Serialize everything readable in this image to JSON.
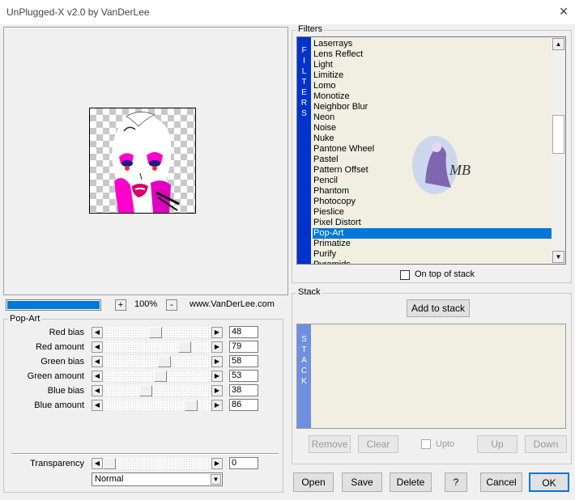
{
  "window": {
    "title": "UnPlugged-X v2.0 by VanDerLee",
    "close_glyph": "×"
  },
  "preview": {
    "progress_fraction": 1.0
  },
  "zoom": {
    "minus": "-",
    "plus": "+",
    "value": "100%"
  },
  "credits": {
    "url": "www.VanDerLee.com"
  },
  "popart": {
    "label": "Pop-Art",
    "sliders": [
      {
        "label": "Red bias",
        "value": "48",
        "fraction": 0.48
      },
      {
        "label": "Red amount",
        "value": "79",
        "fraction": 0.79
      },
      {
        "label": "Green bias",
        "value": "58",
        "fraction": 0.58
      },
      {
        "label": "Green amount",
        "value": "53",
        "fraction": 0.53
      },
      {
        "label": "Blue bias",
        "value": "38",
        "fraction": 0.38
      },
      {
        "label": "Blue amount",
        "value": "86",
        "fraction": 0.86
      }
    ],
    "transparency": {
      "label": "Transparency",
      "value": "0",
      "fraction": 0.0
    },
    "blend_mode": "Normal"
  },
  "filters": {
    "label": "Filters",
    "strip_text": "FILTERS",
    "items": [
      "Laserrays",
      "Lens Reflect",
      "Light",
      "Limitize",
      "Lomo",
      "Monotize",
      "Neighbor Blur",
      "Neon",
      "Noise",
      "Nuke",
      "Pantone Wheel",
      "Pastel",
      "Pattern Offset",
      "Pencil",
      "Phantom",
      "Photocopy",
      "Pieslice",
      "Pixel Distort",
      "Pop-Art",
      "Primatize",
      "Purify",
      "Pyramids"
    ],
    "selected": "Pop-Art",
    "on_top_label": "On top of stack"
  },
  "stack": {
    "label": "Stack",
    "add_button": "Add to stack",
    "strip_text": "STACK",
    "remove": "Remove",
    "clear": "Clear",
    "upto": "Upto",
    "up": "Up",
    "down": "Down"
  },
  "buttons": {
    "open": "Open",
    "save": "Save",
    "delete": "Delete",
    "help": "?",
    "cancel": "Cancel",
    "ok": "OK"
  },
  "watermark": {
    "text": "MB"
  },
  "colors": {
    "accent": "#0078d7",
    "strip_blue": "#0033cc",
    "stack_strip": "#6f8fe0",
    "list_bg": "#f0efe2"
  }
}
